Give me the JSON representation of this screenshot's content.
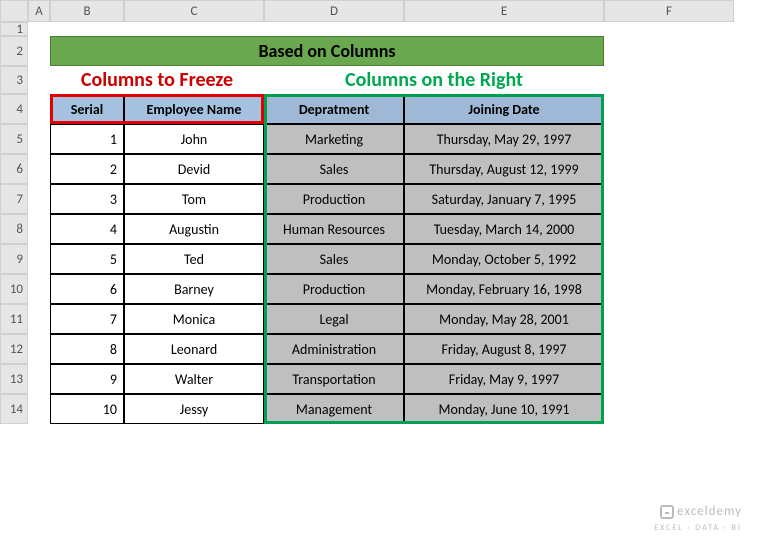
{
  "columns": [
    "A",
    "B",
    "C",
    "D",
    "E",
    "F"
  ],
  "row_numbers": [
    1,
    2,
    3,
    4,
    5,
    6,
    7,
    8,
    9,
    10,
    11,
    12,
    13,
    14
  ],
  "title": "Based on Columns",
  "section_left": "Columns to Freeze",
  "section_right": "Columns on the Right",
  "headers": {
    "serial": "Serial",
    "employee": "Employee Name",
    "department": "Depratment",
    "joining": "Joining Date"
  },
  "rows": [
    {
      "serial": 1,
      "employee": "John",
      "department": "Marketing",
      "joining": "Thursday, May 29, 1997"
    },
    {
      "serial": 2,
      "employee": "Devid",
      "department": "Sales",
      "joining": "Thursday, August 12, 1999"
    },
    {
      "serial": 3,
      "employee": "Tom",
      "department": "Production",
      "joining": "Saturday, January 7, 1995"
    },
    {
      "serial": 4,
      "employee": "Augustin",
      "department": "Human Resources",
      "joining": "Tuesday, March 14, 2000"
    },
    {
      "serial": 5,
      "employee": "Ted",
      "department": "Sales",
      "joining": "Monday, October 5, 1992"
    },
    {
      "serial": 6,
      "employee": "Barney",
      "department": "Production",
      "joining": "Monday, February 16, 1998"
    },
    {
      "serial": 7,
      "employee": "Monica",
      "department": "Legal",
      "joining": "Monday, May 28, 2001"
    },
    {
      "serial": 8,
      "employee": "Leonard",
      "department": "Administration",
      "joining": "Friday, August 8, 1997"
    },
    {
      "serial": 9,
      "employee": "Walter",
      "department": "Transportation",
      "joining": "Friday, May 9, 1997"
    },
    {
      "serial": 10,
      "employee": "Jessy",
      "department": "Management",
      "joining": "Monday, June 10, 1991"
    }
  ],
  "watermark": {
    "brand": "exceldemy",
    "tag": "EXCEL · DATA · BI"
  },
  "chart_data": {
    "type": "table",
    "title": "Based on Columns",
    "columns": [
      "Serial",
      "Employee Name",
      "Depratment",
      "Joining Date"
    ],
    "data": [
      [
        1,
        "John",
        "Marketing",
        "Thursday, May 29, 1997"
      ],
      [
        2,
        "Devid",
        "Sales",
        "Thursday, August 12, 1999"
      ],
      [
        3,
        "Tom",
        "Production",
        "Saturday, January 7, 1995"
      ],
      [
        4,
        "Augustin",
        "Human Resources",
        "Tuesday, March 14, 2000"
      ],
      [
        5,
        "Ted",
        "Sales",
        "Monday, October 5, 1992"
      ],
      [
        6,
        "Barney",
        "Production",
        "Monday, February 16, 1998"
      ],
      [
        7,
        "Monica",
        "Legal",
        "Monday, May 28, 2001"
      ],
      [
        8,
        "Leonard",
        "Administration",
        "Friday, August 8, 1997"
      ],
      [
        9,
        "Walter",
        "Transportation",
        "Friday, May 9, 1997"
      ],
      [
        10,
        "Jessy",
        "Management",
        "Monday, June 10, 1991"
      ]
    ]
  }
}
